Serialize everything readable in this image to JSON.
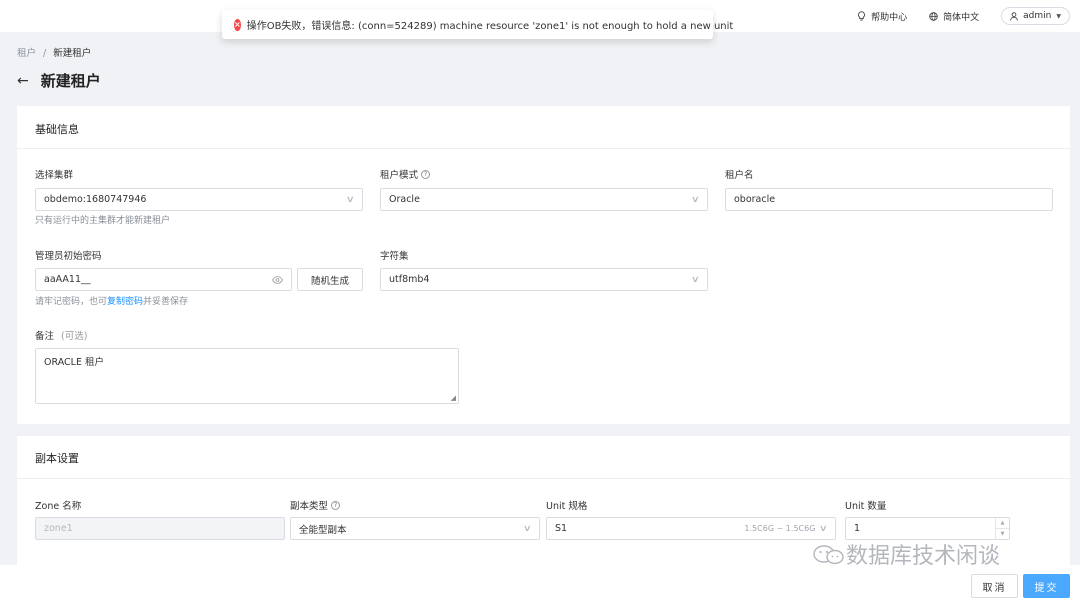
{
  "toast": {
    "message": "操作OB失败，错误信息: (conn=524289) machine resource 'zone1' is not enough to hold a new unit"
  },
  "topbar": {
    "help": "帮助中心",
    "language": "简体中文",
    "user": "admin"
  },
  "breadcrumb": {
    "root": "租户",
    "separator": "/",
    "current": "新建租户"
  },
  "page": {
    "title": "新建租户"
  },
  "basic": {
    "title": "基础信息",
    "cluster_label": "选择集群",
    "cluster_value": "obdemo:1680747946",
    "cluster_hint": "只有运行中的主集群才能新建租户",
    "mode_label": "租户模式",
    "mode_value": "Oracle",
    "name_label": "租户名",
    "name_value": "oboracle",
    "password_label": "管理员初始密码",
    "password_value": "aaAA11__",
    "random_button": "随机生成",
    "password_hint_pre": "请牢记密码，也可",
    "password_hint_link": "复制密码",
    "password_hint_post": "并妥善保存",
    "charset_label": "字符集",
    "charset_value": "utf8mb4",
    "remark_label": "备注",
    "remark_optional": "(可选)",
    "remark_value": "ORACLE  租户"
  },
  "replica": {
    "title": "副本设置",
    "zone_label": "Zone 名称",
    "zone_value": "zone1",
    "type_label": "副本类型",
    "type_value": "全能型副本",
    "spec_label": "Unit 规格",
    "spec_value": "S1",
    "spec_suffix": "1.5C6G ~ 1.5C6G",
    "count_label": "Unit 数量",
    "count_value": "1"
  },
  "watermark": {
    "text": "数据库技术闲谈"
  },
  "footer": {
    "cancel": "取消",
    "submit": "提交"
  }
}
